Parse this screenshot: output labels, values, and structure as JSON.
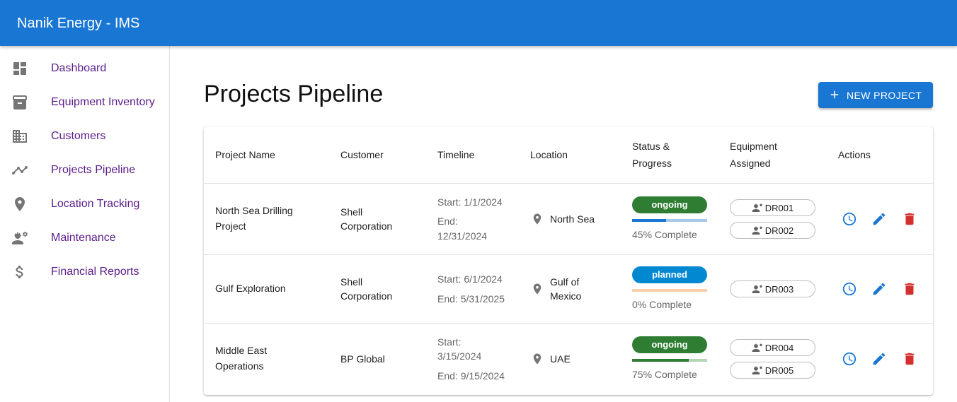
{
  "app": {
    "title": "Nanik Energy - IMS"
  },
  "sidebar": {
    "items": [
      {
        "label": "Dashboard",
        "icon": "dashboard-icon"
      },
      {
        "label": "Equipment Inventory",
        "icon": "archive-icon"
      },
      {
        "label": "Customers",
        "icon": "business-icon"
      },
      {
        "label": "Projects Pipeline",
        "icon": "timeline-icon"
      },
      {
        "label": "Location Tracking",
        "icon": "location-pin-icon"
      },
      {
        "label": "Maintenance",
        "icon": "engineering-icon"
      },
      {
        "label": "Financial Reports",
        "icon": "dollar-icon"
      }
    ]
  },
  "main": {
    "title": "Projects Pipeline",
    "new_button": "NEW PROJECT"
  },
  "table": {
    "headers": {
      "name": "Project Name",
      "customer": "Customer",
      "timeline": "Timeline",
      "location": "Location",
      "status_1": "Status &",
      "status_2": "Progress",
      "equipment_1": "Equipment",
      "equipment_2": "Assigned",
      "actions": "Actions"
    },
    "rows": [
      {
        "name_1": "North Sea Drilling",
        "name_2": "Project",
        "customer_1": "Shell",
        "customer_2": "Corporation",
        "start": "Start: 1/1/2024",
        "end_1": "End:",
        "end_2": "12/31/2024",
        "location_1": "North Sea",
        "status": "ongoing",
        "progress": 45,
        "progress_text": "45% Complete",
        "equipment": [
          "DR001",
          "DR002"
        ]
      },
      {
        "name_1": "Gulf Exploration",
        "customer_1": "Shell",
        "customer_2": "Corporation",
        "start": "Start: 6/1/2024",
        "end_1": "End: 5/31/2025",
        "location_1": "Gulf of",
        "location_2": "Mexico",
        "status": "planned",
        "progress": 0,
        "progress_text": "0% Complete",
        "equipment": [
          "DR003"
        ]
      },
      {
        "name_1": "Middle East",
        "name_2": "Operations",
        "customer_1": "BP Global",
        "start_1": "Start:",
        "start_2": "3/15/2024",
        "end_1": "End: 9/15/2024",
        "location_1": "UAE",
        "status": "ongoing",
        "progress": 75,
        "progress_text": "75% Complete",
        "equipment": [
          "DR004",
          "DR005"
        ]
      }
    ]
  },
  "colors": {
    "primary": "#1976d2",
    "ongoing": "#2e7d32",
    "planned": "#0288d1",
    "planned_track": "#f8cfa9",
    "delete": "#d32f2f",
    "nav_text": "#5c1d8a"
  }
}
